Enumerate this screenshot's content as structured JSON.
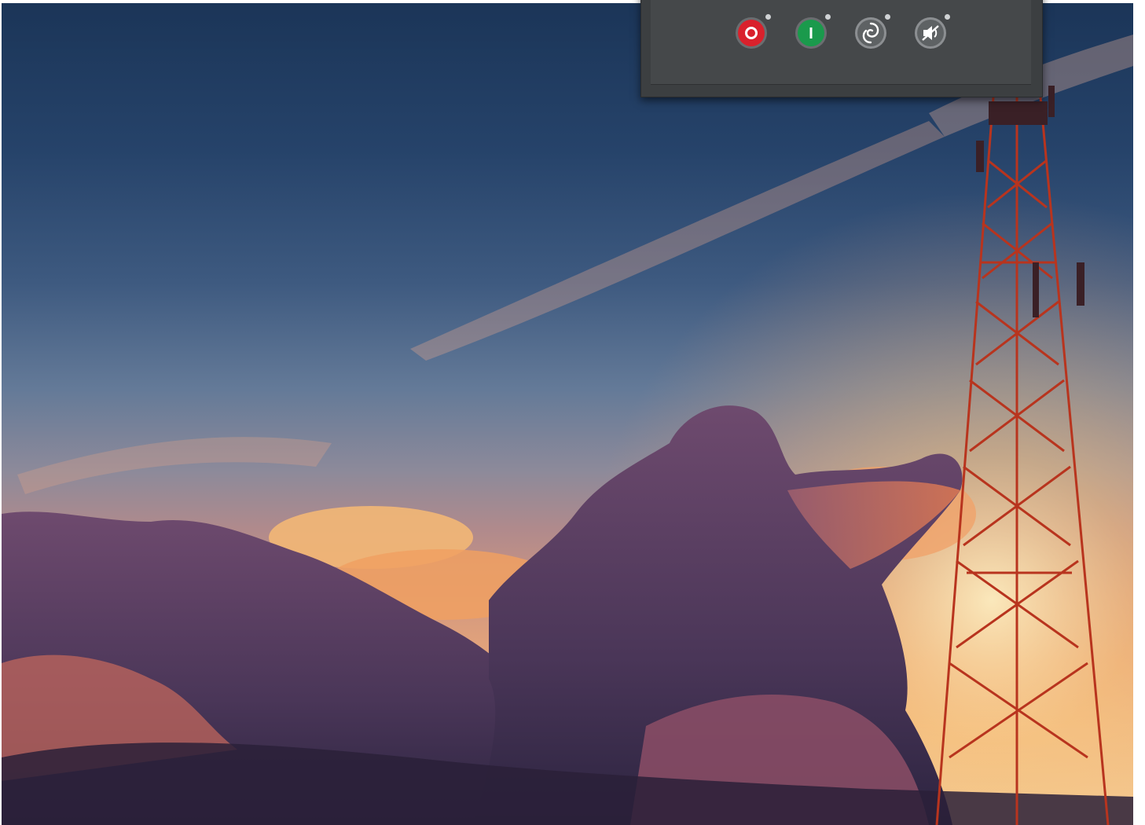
{
  "wallpaper": {
    "description_icon": "sunset-tower-photo"
  },
  "tray": {
    "title": "",
    "buttons": [
      {
        "name": "power-off-button",
        "icon": "power-off-icon",
        "color": "#d9212c"
      },
      {
        "name": "power-on-button",
        "icon": "power-on-icon",
        "color": "#1a9a4c"
      },
      {
        "name": "vortex-button",
        "icon": "vortex-icon",
        "color": "#6c7072"
      },
      {
        "name": "mute-button",
        "icon": "speaker-muted-icon",
        "color": "#6c7072"
      }
    ]
  },
  "colors": {
    "panel": "#3c3f41",
    "red": "#d9212c",
    "green": "#1a9a4c"
  }
}
